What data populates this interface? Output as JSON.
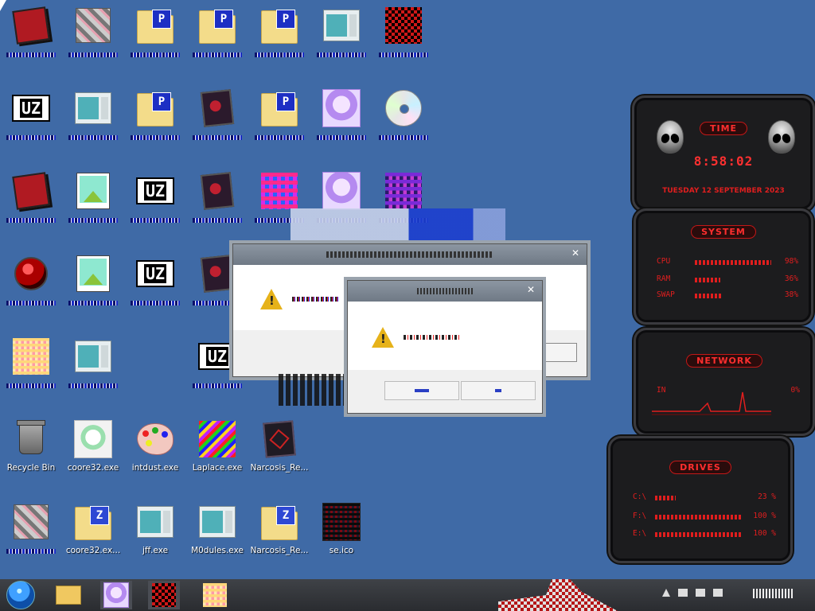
{
  "desktop": {
    "row6_labels": {
      "recycle_bin": "Recycle Bin",
      "coore32": "coore32.exe",
      "intdust": "intdust.exe",
      "laplace": "Laplace.exe",
      "narcosis": "Narcosis_Re..."
    },
    "row7_labels": {
      "coore32_folder": "coore32.ex...",
      "jff": "jff.exe",
      "m0dules": "M0dules.exe",
      "narcosis_folder": "Narcosis_Re...",
      "se_ico": "se.ico"
    },
    "folder_badge_p": "P",
    "folder_badge_z": "Z",
    "uz_tile_text": "UZ"
  },
  "gadgets": {
    "time": {
      "title": "TIME",
      "clock": "8:58:02",
      "date": "TUESDAY 12 SEPTEMBER 2023"
    },
    "system": {
      "title": "SYSTEM",
      "rows": [
        {
          "label": "CPU",
          "value": "98%",
          "level": 0.98
        },
        {
          "label": "RAM",
          "value": "36%",
          "level": 0.36
        },
        {
          "label": "SWAP",
          "value": "38%",
          "level": 0.38
        }
      ]
    },
    "network": {
      "title": "NETWORK",
      "in_label": "IN",
      "in_value": "0%"
    },
    "drives": {
      "title": "DRIVES",
      "rows": [
        {
          "label": "C:\\",
          "value": "23 %",
          "level": 0.23
        },
        {
          "label": "F:\\",
          "value": "100 %",
          "level": 1.0
        },
        {
          "label": "E:\\",
          "value": "100 %",
          "level": 1.0
        }
      ]
    }
  },
  "colors": {
    "desktop_bg": "#3f6aa6",
    "gadget_red": "#e01e1e",
    "taskbar": "#2f3135"
  }
}
